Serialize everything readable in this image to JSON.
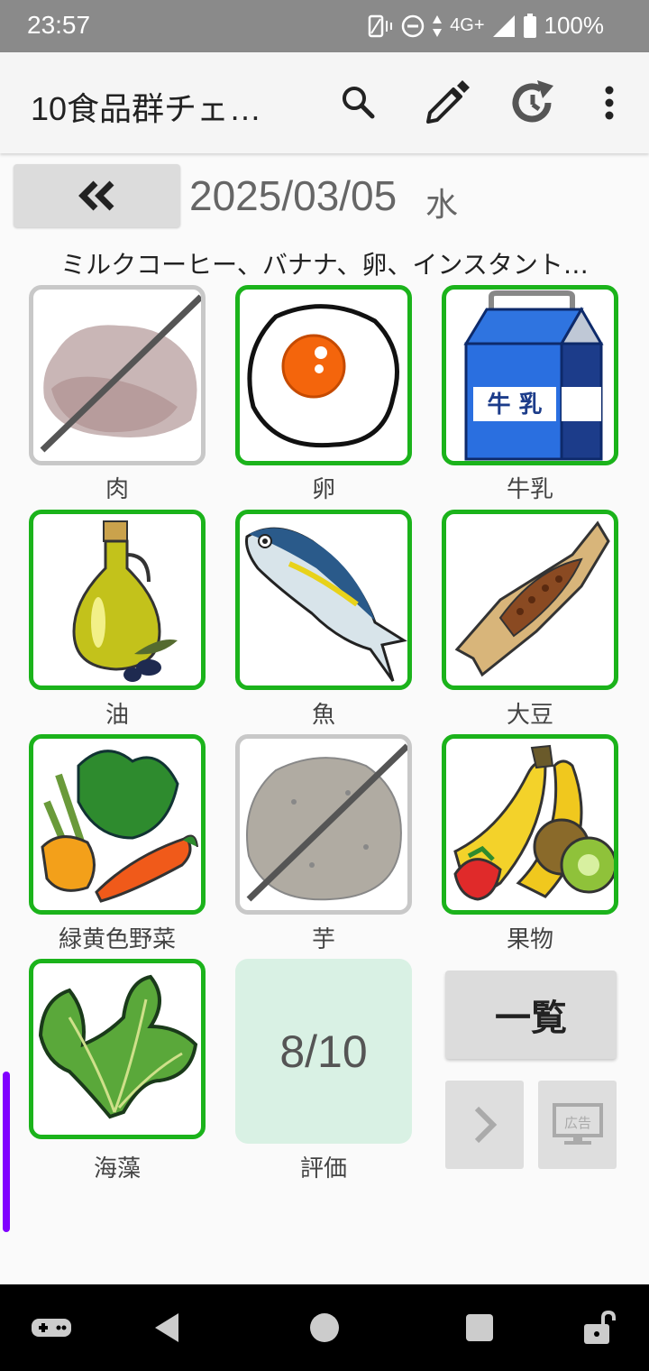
{
  "status_bar": {
    "time": "23:57",
    "network": "4G+",
    "battery": "100%"
  },
  "app_bar": {
    "title": "10食品群チェ…"
  },
  "date": {
    "value": "2025/03/05",
    "weekday": "水"
  },
  "foods_eaten": "ミルクコーヒー、バナナ、卵、インスタント…",
  "groups": [
    {
      "label": "肉",
      "checked": false
    },
    {
      "label": "卵",
      "checked": true
    },
    {
      "label": "牛乳",
      "checked": true
    },
    {
      "label": "油",
      "checked": true
    },
    {
      "label": "魚",
      "checked": true
    },
    {
      "label": "大豆",
      "checked": true
    },
    {
      "label": "緑黄色野菜",
      "checked": true
    },
    {
      "label": "芋",
      "checked": false
    },
    {
      "label": "果物",
      "checked": true
    },
    {
      "label": "海藻",
      "checked": true
    }
  ],
  "milk_carton_text": "牛 乳",
  "evaluation": {
    "score": "8/10",
    "label": "評価"
  },
  "list_button": "一覧",
  "ad_button_text": "広告",
  "colors": {
    "checked_border": "#1bb31b",
    "unchecked_border": "#c8c8c8",
    "evaluation_bg": "#d9f1e4"
  }
}
